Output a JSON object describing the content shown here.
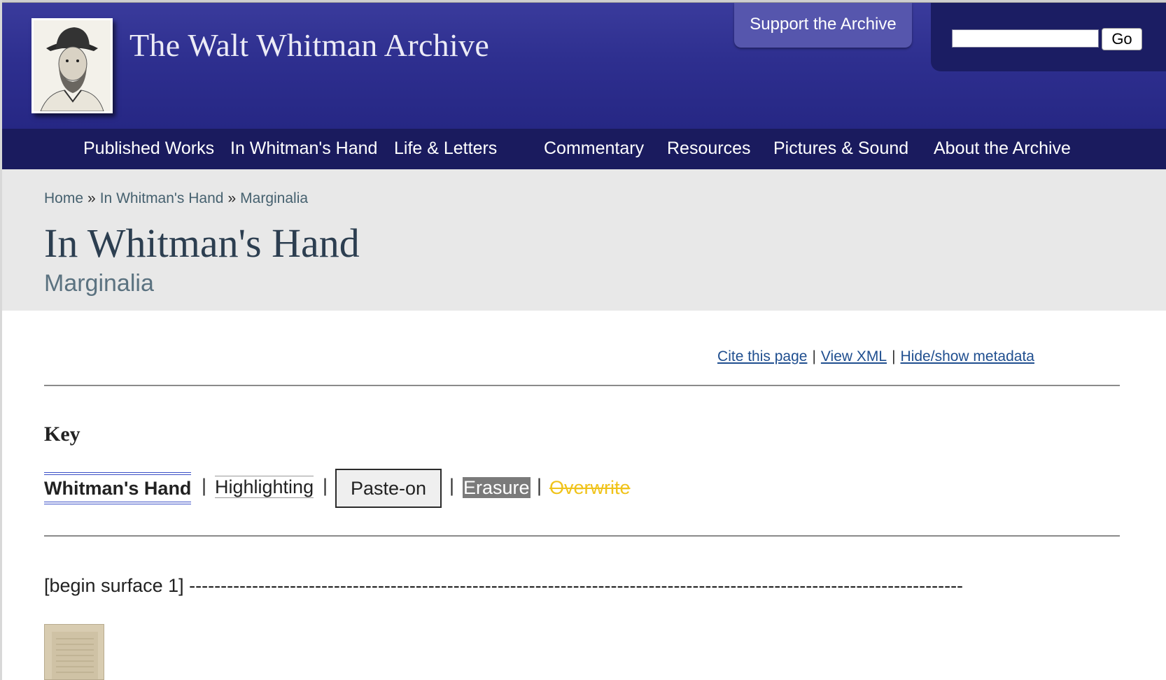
{
  "header": {
    "site_title": "The Walt Whitman Archive",
    "support_label": "Support the Archive",
    "search_placeholder": "",
    "search_value": "",
    "go_label": "Go"
  },
  "nav": {
    "items": [
      {
        "label": "Published Works"
      },
      {
        "label": "In Whitman's Hand"
      },
      {
        "label": "Life & Letters"
      },
      {
        "label": "Commentary"
      },
      {
        "label": "Resources"
      },
      {
        "label": "Pictures & Sound"
      },
      {
        "label": "About the Archive"
      }
    ]
  },
  "breadcrumb": {
    "home": "Home",
    "separator": "»",
    "section": "In Whitman's Hand",
    "current": "Marginalia"
  },
  "page": {
    "title": "In Whitman's Hand",
    "subtitle": "Marginalia"
  },
  "tools": {
    "cite": "Cite this page",
    "view_xml": "View XML",
    "toggle_metadata": "Hide/show metadata",
    "separator": "|"
  },
  "key": {
    "heading": "Key",
    "whitmans_hand": "Whitman's Hand",
    "highlighting": "Highlighting",
    "paste_on": "Paste-on",
    "erasure": "Erasure",
    "overwrite": "Overwrite",
    "separator": "|"
  },
  "content": {
    "surface_label": "[begin surface 1] ---------------------------------------------------------------------------------------------------------------------------"
  },
  "colors": {
    "header_bg": "#2e2f8f",
    "nav_bg": "#1a1b5e",
    "support_bg": "#5656ad",
    "title_band_bg": "#e8e8e8",
    "link": "#1f4e8f",
    "overwrite": "#f0c31a",
    "erasure_bg": "#7a7a7a",
    "whitman_hand_underline": "#3a4fc6"
  },
  "icons": {
    "portrait": "walt-whitman-portrait",
    "thumbnail": "manuscript-page-thumbnail"
  }
}
